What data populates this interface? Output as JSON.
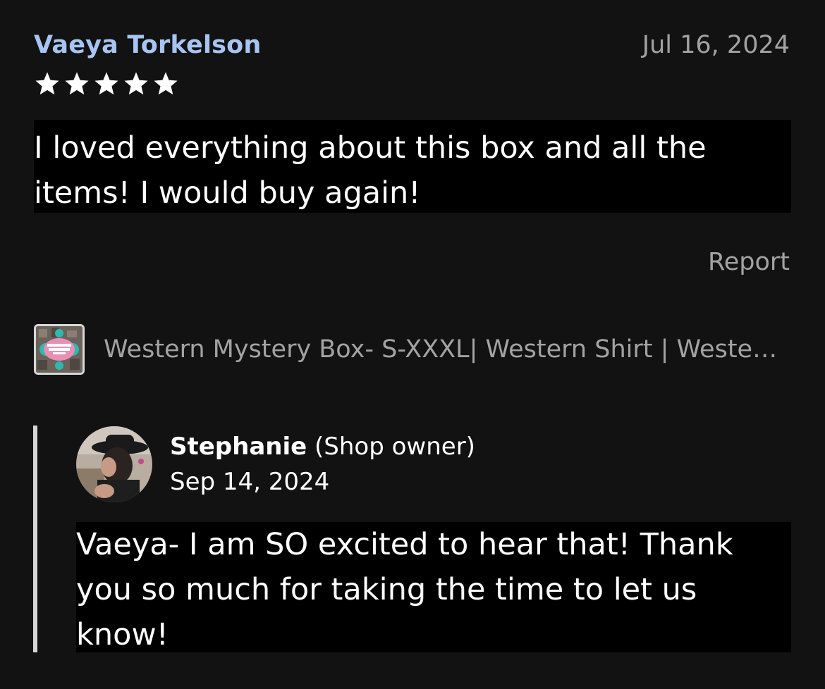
{
  "review": {
    "reviewer_name": "Vaeya Torkelson",
    "date": "Jul 16, 2024",
    "rating": 5,
    "rating_max": 5,
    "text": "I loved everything about this box and all the items! I would buy again!",
    "report_label": "Report"
  },
  "product": {
    "thumbnail_icon": "product-thumbnail",
    "thumbnail_logo_text": "Western Mystery Box",
    "title": "Western Mystery Box- S-XXXL| Western Shirt | Western Mystery Box"
  },
  "reply": {
    "owner_name": "Stephanie",
    "owner_role": "(Shop owner)",
    "date": "Sep 14, 2024",
    "text": "Vaeya- I am SO excited to hear that!  Thank you so much for taking the time to let us know!"
  },
  "colors": {
    "background": "#121212",
    "reviewer_name": "#a7c4f2",
    "muted_text": "#a3a3a3",
    "text_highlight_bg": "#000000",
    "reply_bar": "#d6d6d6"
  }
}
